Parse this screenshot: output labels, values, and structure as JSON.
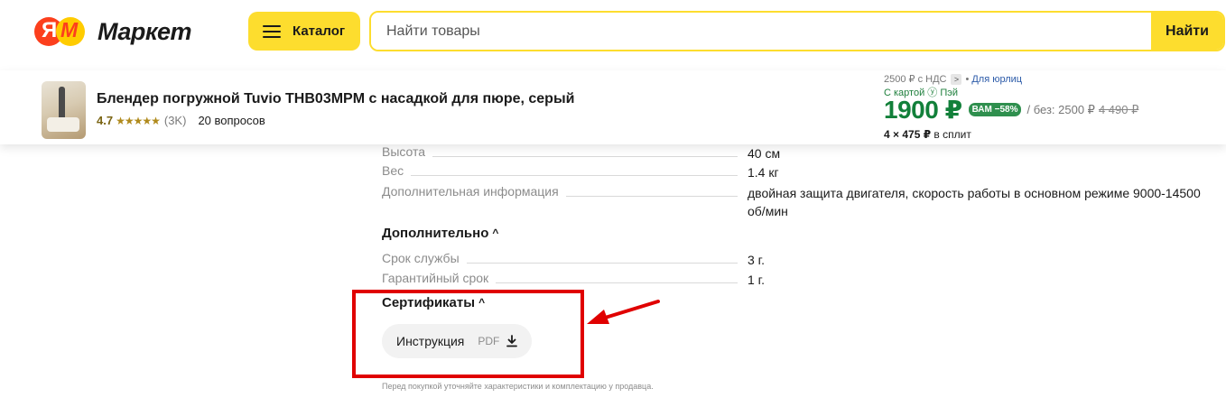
{
  "header": {
    "logo_y": "Я",
    "logo_m": "М",
    "logo_text": "Маркет",
    "catalog_label": "Каталог",
    "search_placeholder": "Найти товары",
    "search_button": "Найти"
  },
  "product": {
    "title": "Блендер погружной Tuvio THB03MPM с насадкой для пюре, серый",
    "rating": "4.7",
    "stars": "★★★★★",
    "reviews": "(3K)",
    "questions": "20 вопросов",
    "vat_price": "2500 ₽ с НДС",
    "vat_arrow": ">",
    "vat_sep": "•",
    "legal_link": "Для юрлиц",
    "card_text": "С картой ⓨ Пэй",
    "price": "1900 ₽",
    "discount_badge": "ВАМ −58%",
    "price_without": "/ без: 2500 ₽",
    "price_old": "4 490 ₽",
    "split_amount": "4 × 475 ₽",
    "split_text": "в сплит"
  },
  "specs": {
    "height": {
      "label": "Высота",
      "value": "40 см"
    },
    "weight": {
      "label": "Вес",
      "value": "1.4 кг"
    },
    "extra_info": {
      "label": "Дополнительная информация",
      "value": "двойная защита двигателя, скорость работы в основном режиме 9000-14500 об/мин"
    }
  },
  "additional": {
    "title": "Дополнительно",
    "caret": "^",
    "service_life": {
      "label": "Срок службы",
      "value": "3 г."
    },
    "warranty": {
      "label": "Гарантийный срок",
      "value": "1 г."
    }
  },
  "certificates": {
    "title": "Сертификаты",
    "caret": "^",
    "instruction_label": "Инструкция",
    "instruction_format": "PDF"
  },
  "disclaimer": "Перед покупкой уточняйте характеристики и комплектацию у продавца.",
  "colors": {
    "accent_yellow": "#fddd2e",
    "price_green": "#12803a",
    "annotation_red": "#e00000"
  }
}
